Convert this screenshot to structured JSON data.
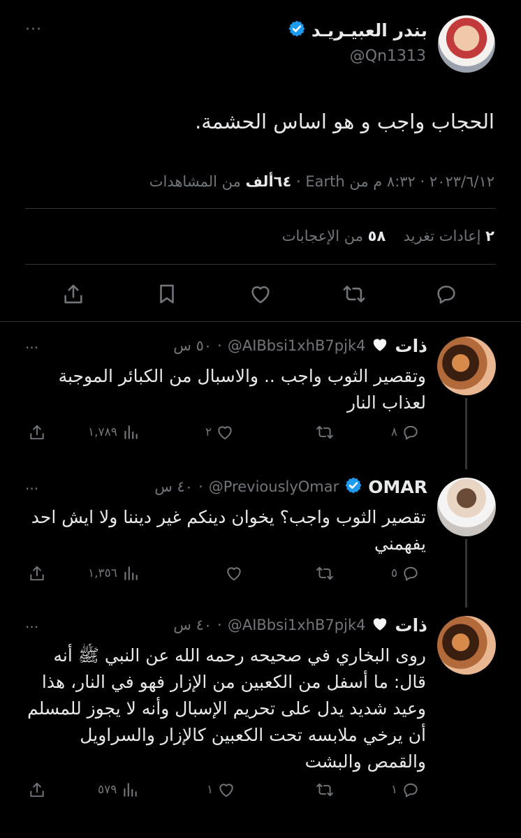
{
  "main_tweet": {
    "display_name": "بندر العبيـريـد",
    "handle": "@Qn1313",
    "more": "···",
    "text": "الحجاب واجب و هو اساس الحشمة.",
    "meta": {
      "date": "٢٠٢٣/٦/١٢",
      "time": "٨:٣٢ م من Earth",
      "views_count": "٦٤ألف",
      "views_label": "من المشاهدات"
    },
    "stats": {
      "retweets_count": "٢",
      "retweets_label": "إعادات تغريد",
      "likes_count": "٥٨",
      "likes_label": "من الإعجابات"
    }
  },
  "replies": [
    {
      "display_name": "ذات",
      "handle": "@AIBbsi1xhB7pjk4",
      "time": "٥٠ س",
      "text": "وتقصير الثوب واجب .. والاسبال من الكبائر الموجبة لعذاب النار",
      "replies": "٨",
      "retweets": "",
      "likes": "٢",
      "views": "١,٧٨٩"
    },
    {
      "display_name": "OMAR",
      "handle": "@PreviouslyOmar",
      "time": "٤٠ س",
      "text": "تقصير الثوب واجب؟ يخوان دينكم غير ديننا ولا ايش احد يفهمني",
      "replies": "٥",
      "retweets": "",
      "likes": "",
      "views": "١,٣٥٦"
    },
    {
      "display_name": "ذات",
      "handle": "@AIBbsi1xhB7pjk4",
      "time": "٤٠ س",
      "text": "روى البخاري في صحيحه رحمه الله عن النبي ﷺ أنه قال: ما أسفل من الكعبين من الإزار فهو في النار، هذا وعيد شديد يدل على تحريم الإسبال وأنه لا يجوز للمسلم أن يرخي ملابسه تحت الكعبين كالإزار والسراويل والقمص والبشت",
      "replies": "١",
      "retweets": "",
      "likes": "١",
      "views": "٥٧٩"
    }
  ],
  "colors": {
    "background": "#000000",
    "text": "#e7e9ea",
    "muted": "#71767b",
    "verified": "#1d9bf0",
    "separator": "#2f3336"
  }
}
